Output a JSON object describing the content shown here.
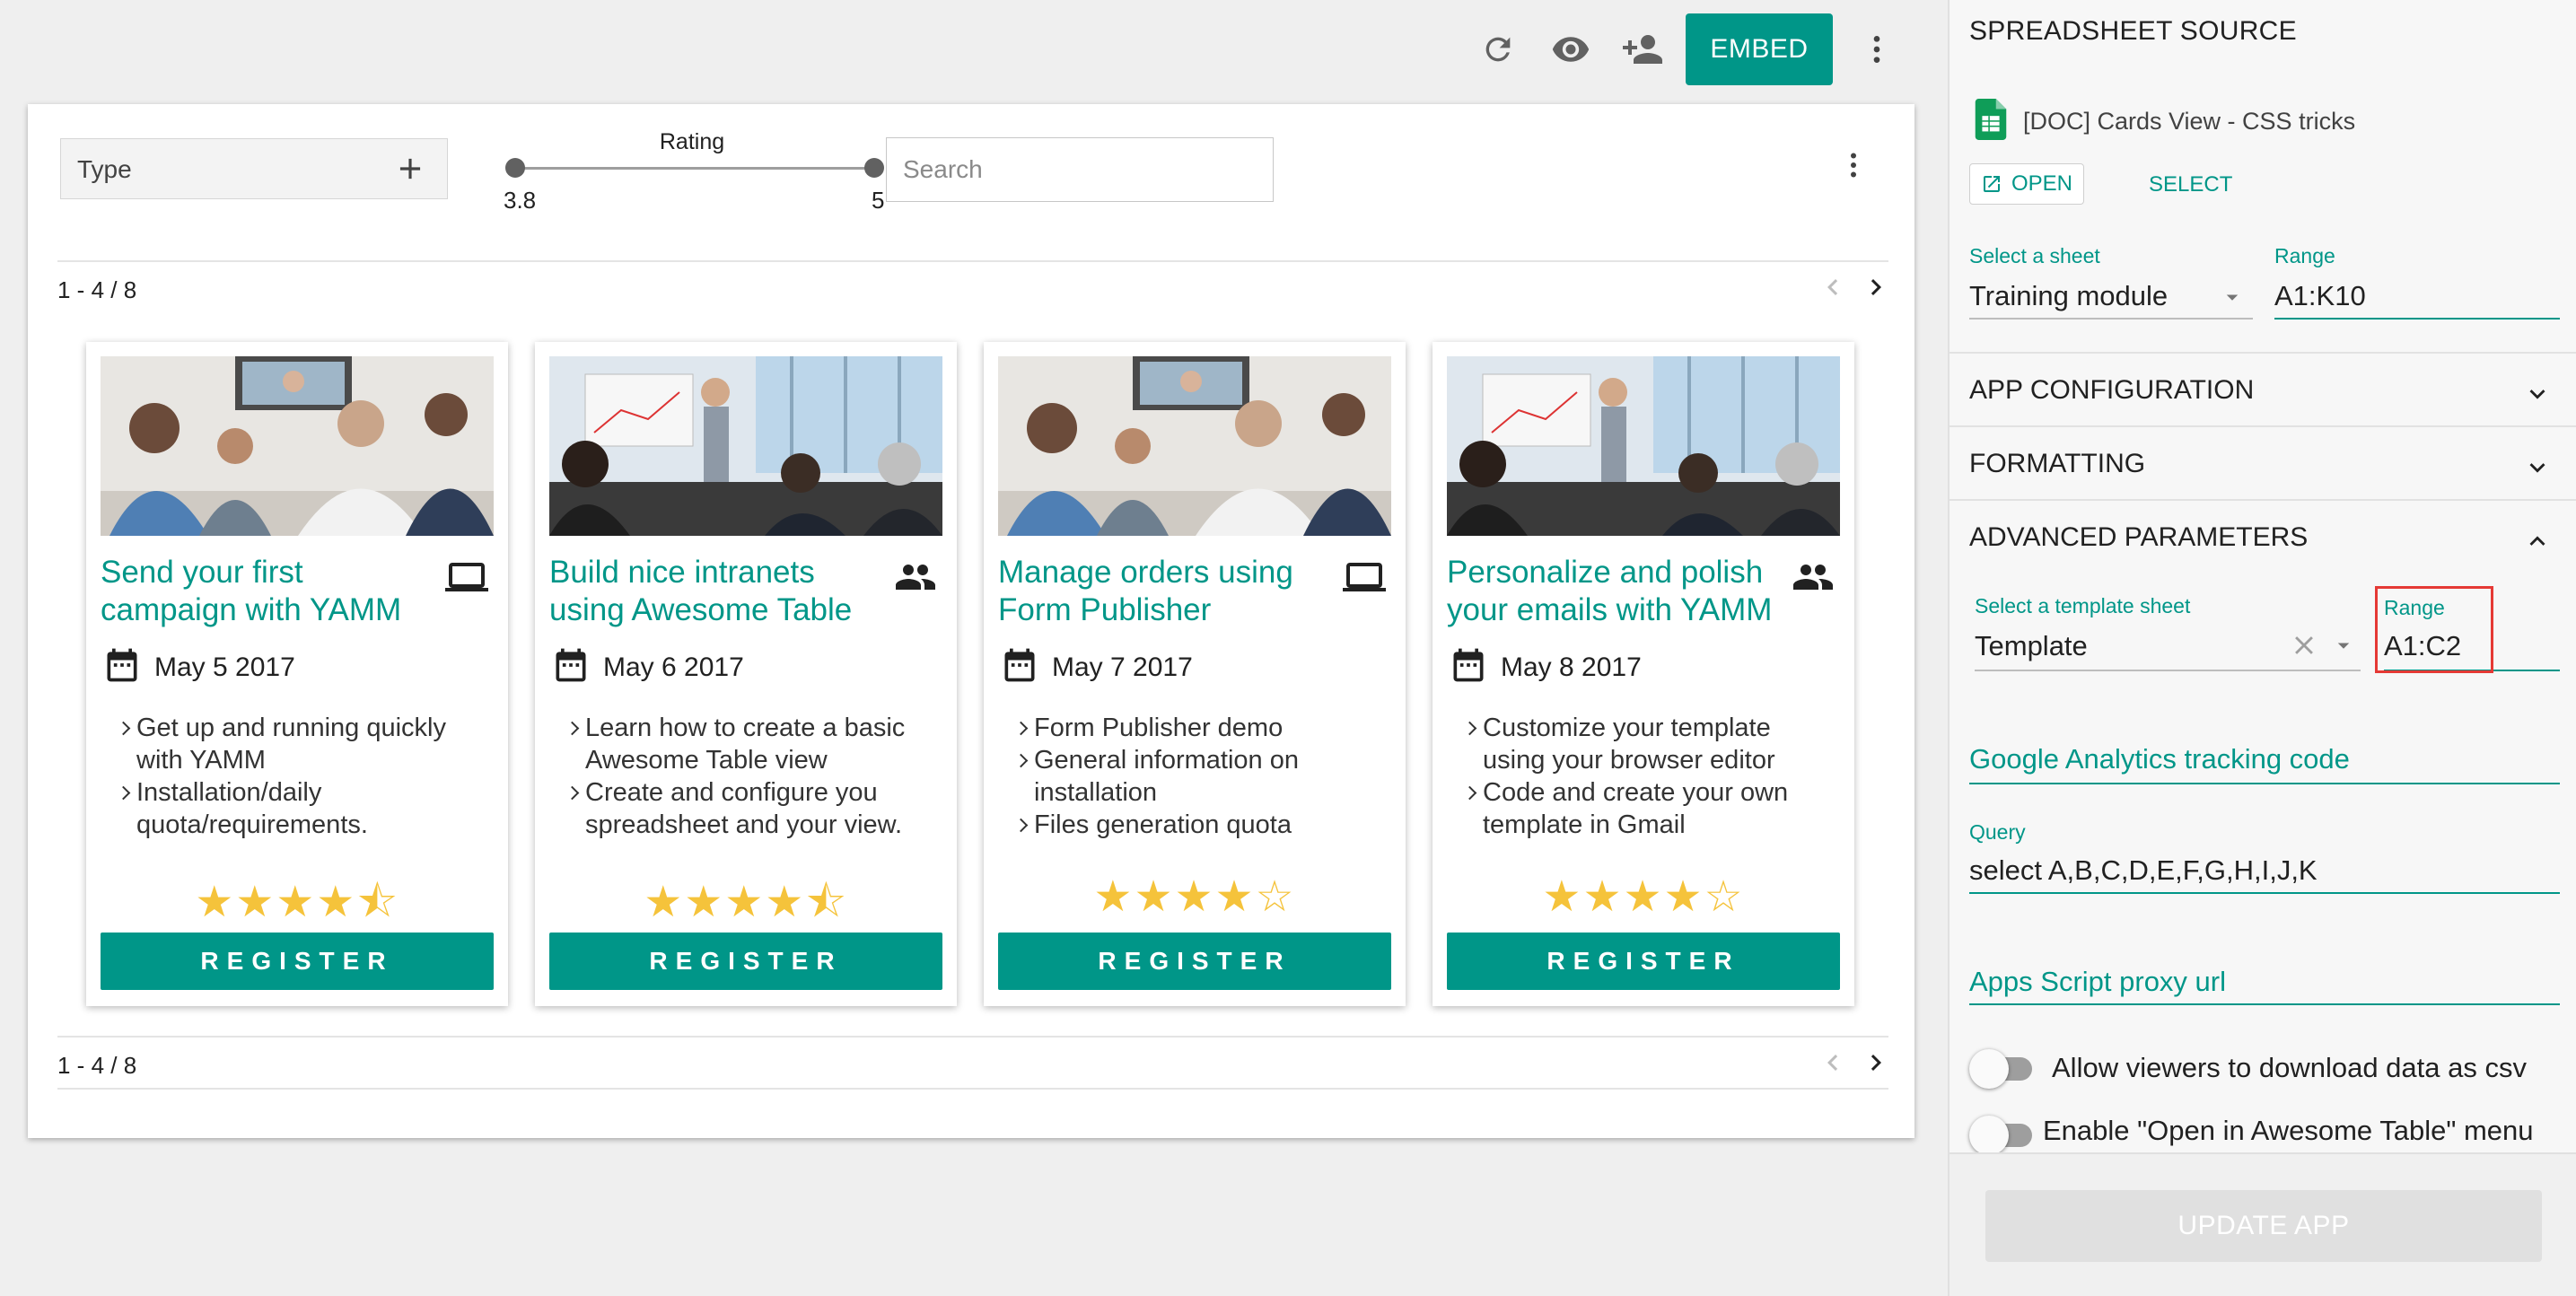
{
  "toolbar": {
    "embed_label": "EMBED"
  },
  "filters": {
    "type_label": "Type",
    "rating_label": "Rating",
    "rating_min": "3.8",
    "rating_max": "5",
    "search_placeholder": "Search"
  },
  "pagination": {
    "top": "1 - 4 / 8",
    "bottom": "1 - 4 / 8"
  },
  "cards": [
    {
      "title": "Send your first campaign with YAMM",
      "icon": "laptop-icon",
      "date": "May 5 2017",
      "bullets": [
        "Get up and running quickly with YAMM",
        "Installation/daily quota/requirements."
      ],
      "rating": 4.5,
      "stars": "★★★★⯪",
      "button": "REGISTER"
    },
    {
      "title": "Build nice intranets using Awesome Table",
      "icon": "people-icon",
      "date": "May 6 2017",
      "bullets": [
        "Learn how to create a basic Awesome Table view",
        "Create and configure you spreadsheet and your view."
      ],
      "rating": 4.5,
      "stars": "★★★★⯪",
      "button": "REGISTER"
    },
    {
      "title": "Manage orders using Form Publisher",
      "icon": "laptop-icon",
      "date": "May 7 2017",
      "bullets": [
        "Form Publisher demo",
        "General information on installation",
        "Files generation quota"
      ],
      "rating": 4,
      "stars": "★★★★☆",
      "button": "REGISTER"
    },
    {
      "title": "Personalize and polish your emails with YAMM",
      "icon": "people-icon",
      "date": "May 8 2017",
      "bullets": [
        "Customize your template using your browser editor",
        "Code and create your own template in Gmail"
      ],
      "rating": 4,
      "stars": "★★★★☆",
      "button": "REGISTER"
    }
  ],
  "panel": {
    "title": "SPREADSHEET SOURCE",
    "doc_name": "[DOC] Cards View - CSS tricks",
    "open_label": "OPEN",
    "select_label": "SELECT",
    "sheet_label": "Select a sheet",
    "sheet_value": "Training module",
    "range_label": "Range",
    "range_value": "A1:K10",
    "sections": {
      "app_config": "APP CONFIGURATION",
      "formatting": "FORMATTING",
      "advanced": "ADVANCED PARAMETERS"
    },
    "template_label": "Select a template sheet",
    "template_value": "Template",
    "template_range_label": "Range",
    "template_range_value": "A1:C2",
    "ga_placeholder": "Google Analytics tracking code",
    "query_label": "Query",
    "query_value": "select A,B,C,D,E,F,G,H,I,J,K",
    "proxy_placeholder": "Apps Script proxy url",
    "toggle_csv": "Allow viewers to download data as csv",
    "toggle_open": "Enable \"Open in Awesome Table\" menu",
    "update_button": "UPDATE APP"
  },
  "colors": {
    "accent": "#009688",
    "star": "#f5c33b",
    "highlight": "#e53935"
  }
}
